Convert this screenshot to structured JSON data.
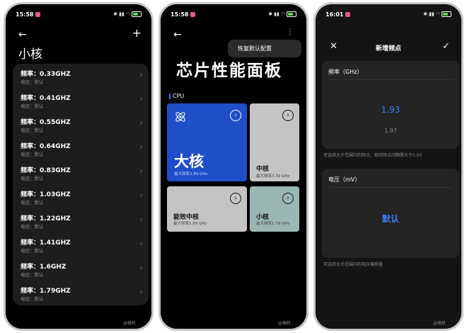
{
  "phone1": {
    "status": {
      "time": "15:58"
    },
    "title": "小核",
    "items": [
      {
        "freq": "频率：0.33GHZ",
        "volt": "电压：默认"
      },
      {
        "freq": "频率：0.41GHZ",
        "volt": "电压：默认"
      },
      {
        "freq": "频率：0.55GHZ",
        "volt": "电压：默认"
      },
      {
        "freq": "频率：0.64GHZ",
        "volt": "电压：默认"
      },
      {
        "freq": "频率：0.83GHZ",
        "volt": "电压：默认"
      },
      {
        "freq": "频率：1.03GHZ",
        "volt": "电压：默认"
      },
      {
        "freq": "频率：1.22GHZ",
        "volt": "电压：默认"
      },
      {
        "freq": "频率：1.41GHZ",
        "volt": "电压：默认"
      },
      {
        "freq": "频率：1.6GHZ",
        "volt": "电压：默认"
      },
      {
        "freq": "频率：1.79GHZ",
        "volt": "电压：默认"
      }
    ]
  },
  "phone2": {
    "status": {
      "time": "15:58"
    },
    "menu_item": "恢复默认配置",
    "title": "芯片性能面板",
    "section": "CPU",
    "cards": {
      "big": {
        "name": "大核",
        "sub": "最大频率3.89 GHz"
      },
      "mid": {
        "name": "中核",
        "sub": "最大频率3.39 GHz"
      },
      "eff": {
        "name": "能效中核",
        "sub": "最大频率1.89 GHz"
      },
      "small": {
        "name": "小核",
        "sub": "最大频率1.79 GHz"
      }
    }
  },
  "phone3": {
    "status": {
      "time": "16:01"
    },
    "header_title": "新增频点",
    "freq_label": "频率（GHz）",
    "freq_selected": "1.93",
    "freq_next": "1.97",
    "freq_note": "可选择允许范围内的频点，相邻频点间隔需大于0.03",
    "volt_label": "电压（mV）",
    "volt_value": "默认",
    "volt_note": "可选择允许范围内的电压偏移量"
  },
  "colors": {
    "accent": "#3d7cf5",
    "big_card": "#1f4ec8",
    "small_card": "#9bb7b3",
    "grey_card": "#c4c4c4"
  },
  "icons": [
    "back-arrow-icon",
    "plus-icon",
    "chevron-right-icon",
    "more-vertical-icon",
    "atom-icon",
    "chevron-circle-icon",
    "close-icon",
    "check-icon"
  ]
}
